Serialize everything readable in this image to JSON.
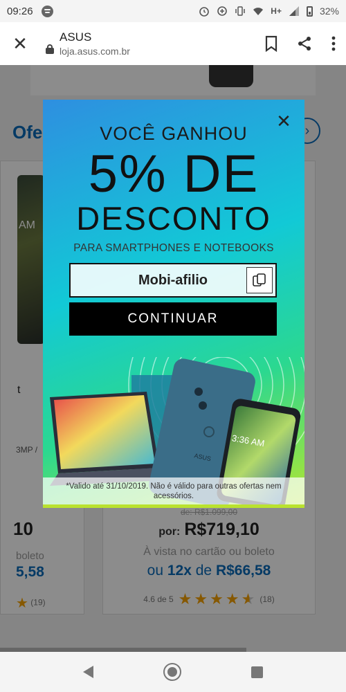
{
  "status_bar": {
    "time": "09:26",
    "network": "H+",
    "battery": "32%"
  },
  "browser": {
    "title": "ASUS",
    "url": "loja.asus.com.br"
  },
  "page": {
    "section_title": "Ofe",
    "left_card": {
      "screen_time": "AM",
      "name_fragment": "t",
      "spec_fragment": "3MP /",
      "price": "10",
      "cash_text": "boleto",
      "installment": "5,58",
      "rating_count": "(19)"
    },
    "right_card": {
      "old_price": "de: R$1.099,00",
      "por_label": "por:",
      "price": "R$719,10",
      "cash_text": "À vista no cartão ou boleto",
      "installment_prefix": "ou",
      "installment_count": "12x",
      "installment_mid": "de",
      "installment_value": "R$66,58",
      "rating_text": "4.6 de 5",
      "rating_value": 4.6,
      "rating_count": "(18)"
    }
  },
  "popup": {
    "headline": "VOCÊ GANHOU",
    "discount_big": "5% DE",
    "discount_word": "DESCONTO",
    "subtitle": "PARA SMARTPHONES E NOTEBOOKS",
    "coupon_code": "Mobi-afilio",
    "continue_label": "CONTINUAR",
    "phone_time": "3:36 AM",
    "phone_brand": "ASUS",
    "disclaimer": "*Valido até 31/10/2019. Não é válido para outras ofertas nem acessórios."
  }
}
